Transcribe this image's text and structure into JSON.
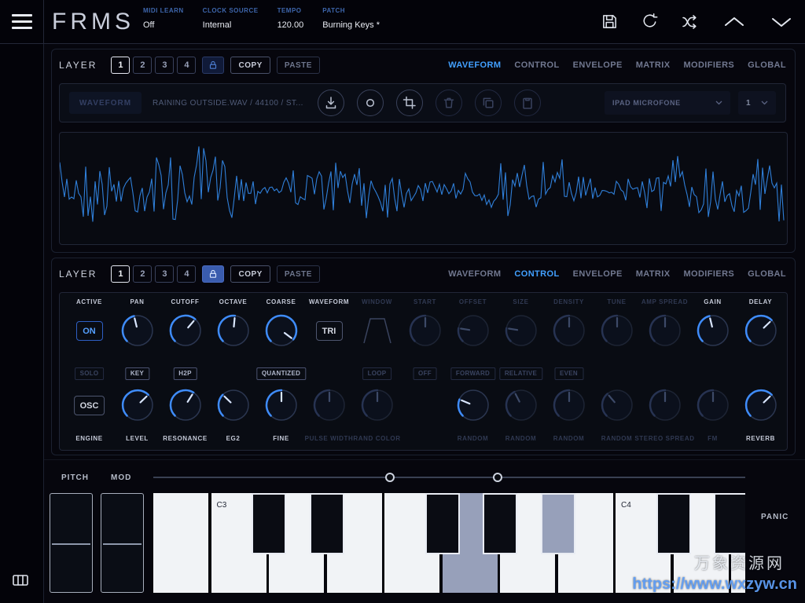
{
  "colors": {
    "accent": "#3f8cfa",
    "tab_active": "#42a0ff",
    "waveform": "#2f7fd9"
  },
  "topbar": {
    "logo": "FRMS",
    "fields": [
      {
        "label": "MIDI LEARN",
        "value": "Off"
      },
      {
        "label": "CLOCK SOURCE",
        "value": "Internal"
      },
      {
        "label": "TEMPO",
        "value": "120.00"
      },
      {
        "label": "PATCH",
        "value": "Burning Keys *"
      }
    ],
    "icons": [
      "save",
      "undo",
      "shuffle",
      "collapse-up",
      "expand-down"
    ]
  },
  "layer1": {
    "label": "LAYER",
    "numbers": [
      "1",
      "2",
      "3",
      "4"
    ],
    "selected": "1",
    "lock_active": false,
    "copy": "COPY",
    "paste": "PASTE",
    "tabs": [
      "WAVEFORM",
      "CONTROL",
      "ENVELOPE",
      "MATRIX",
      "MODIFIERS",
      "GLOBAL"
    ],
    "active_tab": "WAVEFORM"
  },
  "layer2": {
    "label": "LAYER",
    "numbers": [
      "1",
      "2",
      "3",
      "4"
    ],
    "selected": "1",
    "lock_active": true,
    "copy": "COPY",
    "paste": "PASTE",
    "tabs": [
      "WAVEFORM",
      "CONTROL",
      "ENVELOPE",
      "MATRIX",
      "MODIFIERS",
      "GLOBAL"
    ],
    "active_tab": "CONTROL"
  },
  "file_row": {
    "waveform_button": "WAVEFORM",
    "filename": "RAINING OUTSIDE.WAV / 44100 / ST...",
    "icons": [
      {
        "name": "import",
        "bright": true
      },
      {
        "name": "record",
        "bright": true
      },
      {
        "name": "crop",
        "bright": true
      },
      {
        "name": "delete",
        "bright": false
      },
      {
        "name": "duplicate",
        "bright": false
      },
      {
        "name": "clipboard",
        "bright": false
      }
    ],
    "input_source": "IPAD MICROFONE",
    "channel": "1"
  },
  "controls": {
    "columns": [
      {
        "id": "engine",
        "top_label": "ACTIVE",
        "top_bright": true,
        "top": {
          "kind": "button",
          "label": "ON",
          "style": "accent"
        },
        "mid": {
          "label": "SOLO",
          "bright": false
        },
        "bottom": {
          "kind": "button",
          "label": "OSC",
          "style": "normal"
        },
        "bottom_label": "ENGINE",
        "bottom_bright": true
      },
      {
        "id": "pan-level",
        "top_label": "PAN",
        "top_bright": true,
        "top": {
          "kind": "knob",
          "value": 0.45,
          "bright": true
        },
        "mid": {
          "label": "KEY",
          "bright": true
        },
        "bottom": {
          "kind": "knob",
          "value": 0.67,
          "bright": true
        },
        "bottom_label": "LEVEL",
        "bottom_bright": true
      },
      {
        "id": "cutoff-resonance",
        "top_label": "CUTOFF",
        "top_bright": true,
        "top": {
          "kind": "knob",
          "value": 0.65,
          "bright": true
        },
        "mid": {
          "label": "H2P",
          "bright": true
        },
        "bottom": {
          "kind": "knob",
          "value": 0.62,
          "bright": true
        },
        "bottom_label": "RESONANCE",
        "bottom_bright": true
      },
      {
        "id": "octave-eg2",
        "top_label": "OCTAVE",
        "top_bright": true,
        "top": {
          "kind": "knob",
          "value": 0.52,
          "bright": true
        },
        "mid": null,
        "bottom": {
          "kind": "knob",
          "value": 0.33,
          "bright": true
        },
        "bottom_label": "EG2",
        "bottom_bright": true
      },
      {
        "id": "coarse-fine",
        "top_label": "COARSE",
        "top_bright": true,
        "top": {
          "kind": "knob",
          "value": 0.97,
          "bright": true
        },
        "mid": {
          "label": "QUANTIZED",
          "bright": true
        },
        "bottom": {
          "kind": "knob",
          "value": 0.5,
          "bright": true
        },
        "bottom_label": "FINE",
        "bottom_bright": true
      },
      {
        "id": "waveform-pw",
        "top_label": "WAVEFORM",
        "top_bright": true,
        "top": {
          "kind": "button",
          "label": "TRI",
          "style": "normal"
        },
        "mid": null,
        "bottom": {
          "kind": "knob",
          "value": 0.5,
          "bright": false
        },
        "bottom_label": "PULSE WIDTH",
        "bottom_bright": false
      },
      {
        "id": "window-randcolor",
        "top_label": "WINDOW",
        "top_bright": false,
        "top": {
          "kind": "window"
        },
        "mid": {
          "label": "LOOP",
          "bright": false
        },
        "bottom": {
          "kind": "knob",
          "value": 0.5,
          "bright": false
        },
        "bottom_label": "RAND COLOR",
        "bottom_bright": false
      },
      {
        "id": "start",
        "top_label": "START",
        "top_bright": false,
        "top": {
          "kind": "knob",
          "value": 0.5,
          "bright": false
        },
        "mid": {
          "label": "OFF",
          "bright": false
        },
        "bottom": null,
        "bottom_label": "",
        "bottom_bright": false
      },
      {
        "id": "offset-random",
        "top_label": "OFFSET",
        "top_bright": false,
        "top": {
          "kind": "knob",
          "value": 0.2,
          "bright": false
        },
        "mid": {
          "label": "FORWARD",
          "bright": false
        },
        "bottom": {
          "kind": "knob",
          "value": 0.25,
          "bright": true
        },
        "bottom_label": "RANDOM",
        "bottom_bright": false
      },
      {
        "id": "size-random",
        "top_label": "SIZE",
        "top_bright": false,
        "top": {
          "kind": "knob",
          "value": 0.2,
          "bright": false
        },
        "mid": {
          "label": "RELATIVE",
          "bright": false
        },
        "bottom": {
          "kind": "knob",
          "value": 0.4,
          "bright": false
        },
        "bottom_label": "RANDOM",
        "bottom_bright": false
      },
      {
        "id": "density-random",
        "top_label": "DENSITY",
        "top_bright": false,
        "top": {
          "kind": "knob",
          "value": 0.5,
          "bright": false
        },
        "mid": {
          "label": "EVEN",
          "bright": false
        },
        "bottom": {
          "kind": "knob",
          "value": 0.5,
          "bright": false
        },
        "bottom_label": "RANDOM",
        "bottom_bright": false
      },
      {
        "id": "tune-random",
        "top_label": "TUNE",
        "top_bright": false,
        "top": {
          "kind": "knob",
          "value": 0.5,
          "bright": false
        },
        "mid": null,
        "bottom": {
          "kind": "knob",
          "value": 0.35,
          "bright": false
        },
        "bottom_label": "RANDOM",
        "bottom_bright": false
      },
      {
        "id": "ampspread-stereospread",
        "top_label": "AMP SPREAD",
        "top_bright": false,
        "top": {
          "kind": "knob",
          "value": 0.5,
          "bright": false
        },
        "mid": null,
        "bottom": {
          "kind": "knob",
          "value": 0.5,
          "bright": false
        },
        "bottom_label": "STEREO SPREAD",
        "bottom_bright": false
      },
      {
        "id": "gain-fm",
        "top_label": "GAIN",
        "top_bright": true,
        "top": {
          "kind": "knob",
          "value": 0.45,
          "bright": true
        },
        "mid": null,
        "bottom": {
          "kind": "knob",
          "value": 0.5,
          "bright": false
        },
        "bottom_label": "FM",
        "bottom_bright": false
      },
      {
        "id": "delay-reverb",
        "top_label": "DELAY",
        "top_bright": true,
        "top": {
          "kind": "knob",
          "value": 0.67,
          "bright": true
        },
        "mid": null,
        "bottom": {
          "kind": "knob",
          "value": 0.67,
          "bright": true
        },
        "bottom_label": "REVERB",
        "bottom_bright": true
      }
    ]
  },
  "performance": {
    "pitch_label": "PITCH",
    "mod_label": "MOD",
    "panic": "PANIC",
    "slider_handles": [
      0.4,
      0.582
    ]
  },
  "keyboard": {
    "white_keys": [
      {
        "note": "B2"
      },
      {
        "note": "C3",
        "label": "C3"
      },
      {
        "note": "D3"
      },
      {
        "note": "E3"
      },
      {
        "note": "F3"
      },
      {
        "note": "G3",
        "pressed": true
      },
      {
        "note": "A3"
      },
      {
        "note": "B3"
      },
      {
        "note": "C4",
        "label": "C4"
      },
      {
        "note": "D4"
      },
      {
        "note": "E4"
      }
    ],
    "black_keys": [
      {
        "note": "C#3",
        "after": 1
      },
      {
        "note": "D#3",
        "after": 2
      },
      {
        "note": "F#3",
        "after": 4
      },
      {
        "note": "G#3",
        "after": 5
      },
      {
        "note": "A#3",
        "after": 6,
        "pressed": true
      },
      {
        "note": "C#4",
        "after": 8
      },
      {
        "note": "D#4",
        "after": 9
      }
    ]
  },
  "watermark": {
    "line1": "万象资源网",
    "line2": "https://www.wxzyw.cn"
  }
}
